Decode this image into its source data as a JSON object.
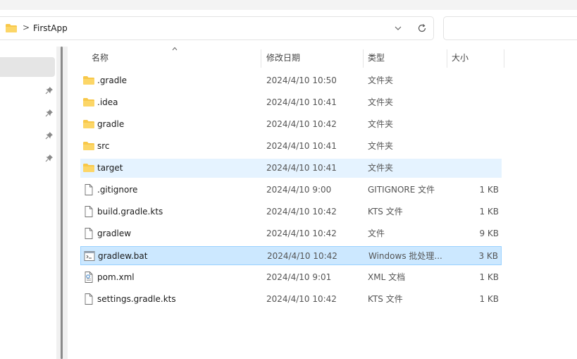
{
  "address": {
    "path": "FirstApp",
    "separator": ">"
  },
  "columns": {
    "name": "名称",
    "date": "修改日期",
    "type": "类型",
    "size": "大小"
  },
  "files": [
    {
      "name": ".gradle",
      "date": "2024/4/10 10:50",
      "type": "文件夹",
      "size": "",
      "icon": "folder-icon"
    },
    {
      "name": ".idea",
      "date": "2024/4/10 10:41",
      "type": "文件夹",
      "size": "",
      "icon": "folder-icon"
    },
    {
      "name": "gradle",
      "date": "2024/4/10 10:42",
      "type": "文件夹",
      "size": "",
      "icon": "folder-icon"
    },
    {
      "name": "src",
      "date": "2024/4/10 10:41",
      "type": "文件夹",
      "size": "",
      "icon": "folder-icon"
    },
    {
      "name": "target",
      "date": "2024/4/10 10:41",
      "type": "文件夹",
      "size": "",
      "icon": "folder-icon"
    },
    {
      "name": ".gitignore",
      "date": "2024/4/10 9:00",
      "type": "GITIGNORE 文件",
      "size": "1 KB",
      "icon": "file-icon"
    },
    {
      "name": "build.gradle.kts",
      "date": "2024/4/10 10:42",
      "type": "KTS 文件",
      "size": "1 KB",
      "icon": "file-icon"
    },
    {
      "name": "gradlew",
      "date": "2024/4/10 10:42",
      "type": "文件",
      "size": "9 KB",
      "icon": "file-icon"
    },
    {
      "name": "gradlew.bat",
      "date": "2024/4/10 10:42",
      "type": "Windows 批处理...",
      "size": "3 KB",
      "icon": "batch-file-icon"
    },
    {
      "name": "pom.xml",
      "date": "2024/4/10 9:01",
      "type": "XML 文档",
      "size": "1 KB",
      "icon": "xml-file-icon"
    },
    {
      "name": "settings.gradle.kts",
      "date": "2024/4/10 10:42",
      "type": "KTS 文件",
      "size": "1 KB",
      "icon": "file-icon"
    }
  ],
  "state": {
    "hover_row": 4,
    "selected_row": 8
  },
  "colors": {
    "folder": "#f8c84a",
    "hover": "#e5f3ff",
    "selected": "#cce8ff",
    "selected_border": "#99d1ff"
  }
}
